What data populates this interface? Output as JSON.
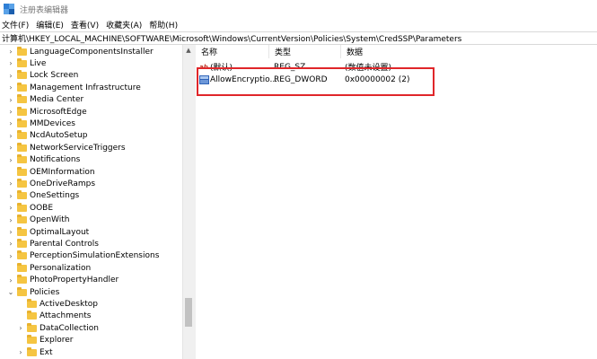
{
  "window": {
    "title": "注册表编辑器"
  },
  "menu": [
    "文件(F)",
    "编辑(E)",
    "查看(V)",
    "收藏夹(A)",
    "帮助(H)"
  ],
  "address": "计算机\\HKEY_LOCAL_MACHINE\\SOFTWARE\\Microsoft\\Windows\\CurrentVersion\\Policies\\System\\CredSSP\\Parameters",
  "tree": {
    "nodes": [
      {
        "label": "LanguageComponentsInstaller",
        "level": 1,
        "expander": ">"
      },
      {
        "label": "Live",
        "level": 1,
        "expander": ">"
      },
      {
        "label": "Lock Screen",
        "level": 1,
        "expander": ">"
      },
      {
        "label": "Management Infrastructure",
        "level": 1,
        "expander": ">"
      },
      {
        "label": "Media Center",
        "level": 1,
        "expander": ">"
      },
      {
        "label": "MicrosoftEdge",
        "level": 1,
        "expander": ">"
      },
      {
        "label": "MMDevices",
        "level": 1,
        "expander": ">"
      },
      {
        "label": "NcdAutoSetup",
        "level": 1,
        "expander": ">"
      },
      {
        "label": "NetworkServiceTriggers",
        "level": 1,
        "expander": ">"
      },
      {
        "label": "Notifications",
        "level": 1,
        "expander": ">"
      },
      {
        "label": "OEMInformation",
        "level": 1,
        "expander": ""
      },
      {
        "label": "OneDriveRamps",
        "level": 1,
        "expander": ">"
      },
      {
        "label": "OneSettings",
        "level": 1,
        "expander": ">"
      },
      {
        "label": "OOBE",
        "level": 1,
        "expander": ">"
      },
      {
        "label": "OpenWith",
        "level": 1,
        "expander": ">"
      },
      {
        "label": "OptimalLayout",
        "level": 1,
        "expander": ">"
      },
      {
        "label": "Parental Controls",
        "level": 1,
        "expander": ">"
      },
      {
        "label": "PerceptionSimulationExtensions",
        "level": 1,
        "expander": ">"
      },
      {
        "label": "Personalization",
        "level": 1,
        "expander": ""
      },
      {
        "label": "PhotoPropertyHandler",
        "level": 1,
        "expander": ">"
      },
      {
        "label": "Policies",
        "level": 1,
        "expander": "v"
      },
      {
        "label": "ActiveDesktop",
        "level": 2,
        "expander": ""
      },
      {
        "label": "Attachments",
        "level": 2,
        "expander": ""
      },
      {
        "label": "DataCollection",
        "level": 2,
        "expander": ">"
      },
      {
        "label": "Explorer",
        "level": 2,
        "expander": ""
      },
      {
        "label": "Ext",
        "level": 2,
        "expander": ">"
      }
    ]
  },
  "list": {
    "columns": [
      "名称",
      "类型",
      "数据"
    ],
    "rows": [
      {
        "name": "(默认)",
        "type": "REG_SZ",
        "data": "(数值未设置)",
        "icon": "string-value-icon"
      },
      {
        "name": "AllowEncryptio...",
        "type": "REG_DWORD",
        "data": "0x00000002 (2)",
        "icon": "binary-value-icon"
      }
    ]
  },
  "colors": {
    "highlight": "#e0262a",
    "folder": "#f5c542"
  }
}
